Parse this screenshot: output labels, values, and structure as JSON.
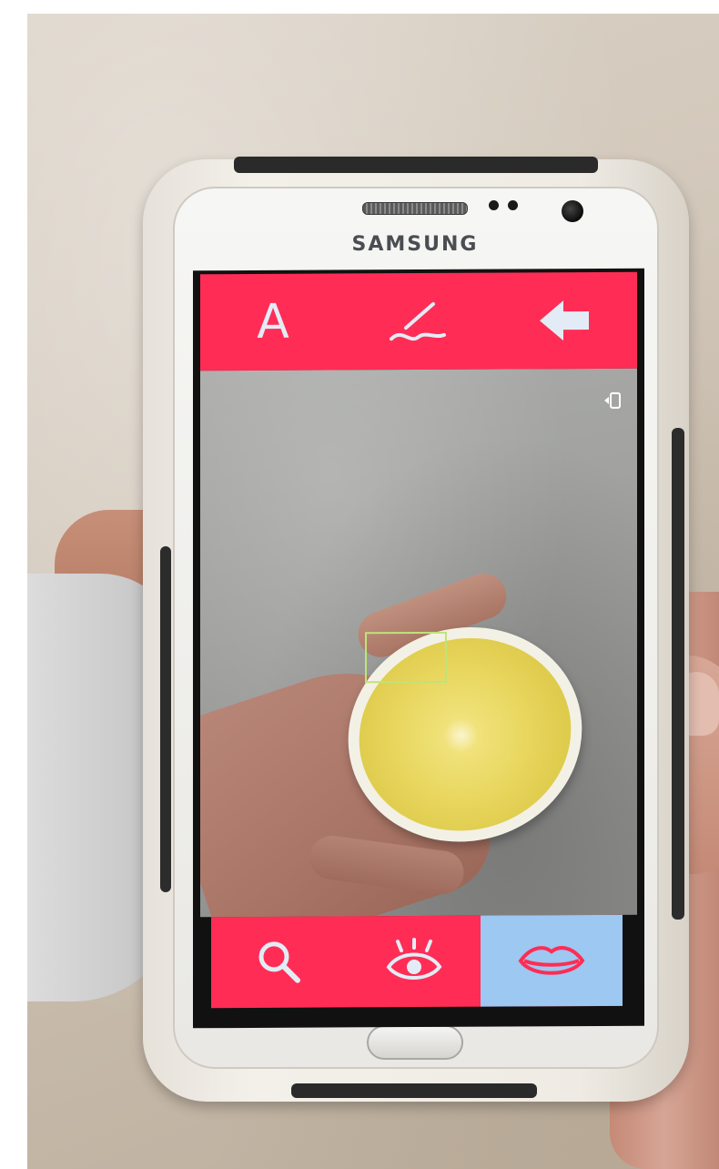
{
  "device": {
    "brand": "SAMSUNG"
  },
  "app": {
    "top_toolbar": {
      "items": [
        {
          "label": "A",
          "icon": "letter-a-icon"
        },
        {
          "icon": "pen-signature-icon"
        },
        {
          "icon": "back-arrow-icon"
        }
      ]
    },
    "camera": {
      "switch_icon": "camera-switch-icon"
    },
    "bottom_toolbar": {
      "items": [
        {
          "icon": "search-icon",
          "active": false
        },
        {
          "icon": "eye-icon",
          "active": false
        },
        {
          "icon": "lips-icon",
          "active": true
        }
      ]
    },
    "colors": {
      "toolbar": "#ff2d55",
      "icon": "#e3ecf6",
      "active_tab": "#9cc8f1",
      "focus_box": "#bfe37a"
    }
  }
}
